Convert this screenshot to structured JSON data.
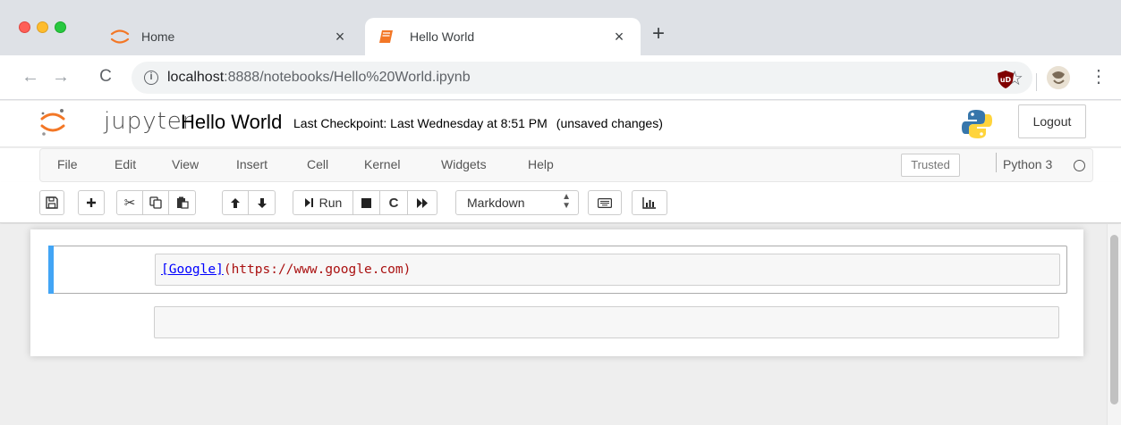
{
  "browser": {
    "tabs": [
      {
        "title": "Home",
        "icon": "jupyter-spinner-icon",
        "active": false
      },
      {
        "title": "Hello World",
        "icon": "notebook-icon",
        "active": true
      }
    ],
    "close_glyph": "×",
    "new_tab_glyph": "+",
    "url": {
      "host": "localhost",
      "rest": ":8888/notebooks/Hello%20World.ipynb"
    }
  },
  "header": {
    "brand": "jupyter",
    "notebook_title": "Hello World",
    "checkpoint": "Last Checkpoint: Last Wednesday at 8:51 PM",
    "autosave_status": "(unsaved changes)",
    "logout_label": "Logout"
  },
  "menubar": {
    "items": [
      "File",
      "Edit",
      "View",
      "Insert",
      "Cell",
      "Kernel",
      "Widgets",
      "Help"
    ],
    "trusted_label": "Trusted",
    "kernel_name": "Python 3"
  },
  "toolbar": {
    "run_label": "Run",
    "cell_type": "Markdown"
  },
  "notebook": {
    "cells": [
      {
        "type": "markdown",
        "link_text": "[Google]",
        "link_url": "(https://www.google.com)",
        "selected": true
      },
      {
        "type": "code",
        "source": "",
        "selected": false
      }
    ]
  },
  "colors": {
    "selected_cell_bar": "#42a5f5",
    "md_link": "#0000ff",
    "md_url": "#aa1111",
    "tab_strip": "#dee1e6"
  }
}
